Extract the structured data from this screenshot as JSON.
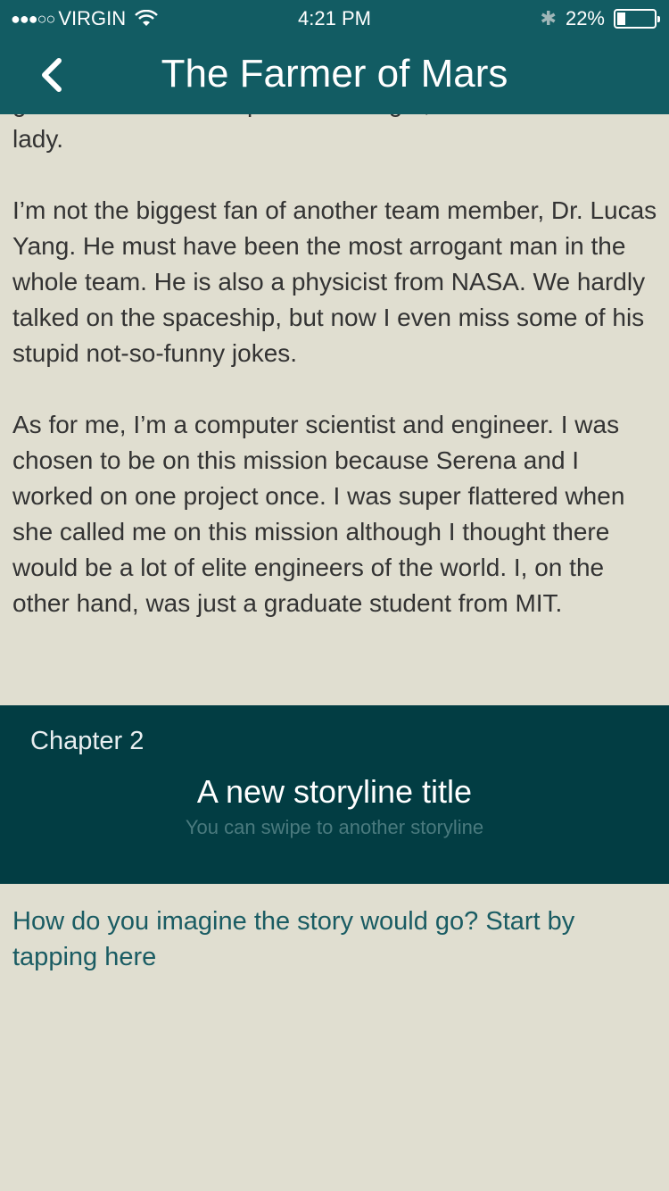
{
  "status_bar": {
    "signal": "●●●○○",
    "carrier": "VIRGIN",
    "time": "4:21 PM",
    "battery_percent": "22%",
    "battery_level": 0.22
  },
  "nav": {
    "title": "The Farmer of Mars",
    "back_icon": "chevron-left-icon"
  },
  "story": {
    "paragraphs": [
      "good care of the samples we brought, such as sweet",
      "lady.",
      "I’m not the biggest fan of another team member, Dr. Lucas Yang. He must have been the most arrogant man in the whole team. He is also a physicist from NASA. We hardly talked on the spaceship, but now I even miss some of his stupid not-so-funny jokes.",
      "As for me, I’m a computer scientist and engineer. I was chosen to be on this mission because Serena and I worked on one project once. I was super flattered when she called me on this mission although I thought there would be a lot of elite engineers of the world. I, on the other hand, was just a graduate student from MIT."
    ]
  },
  "chapter": {
    "label": "Chapter 2",
    "title": "A new storyline title",
    "hint": "You can swipe to another storyline"
  },
  "prompt": {
    "text": "How do you imagine the story would go? Start by tapping here"
  },
  "colors": {
    "nav": "#125c63",
    "background": "#e0ded0",
    "chapter_bg": "#023d43",
    "prompt_text": "#1a5c63"
  }
}
